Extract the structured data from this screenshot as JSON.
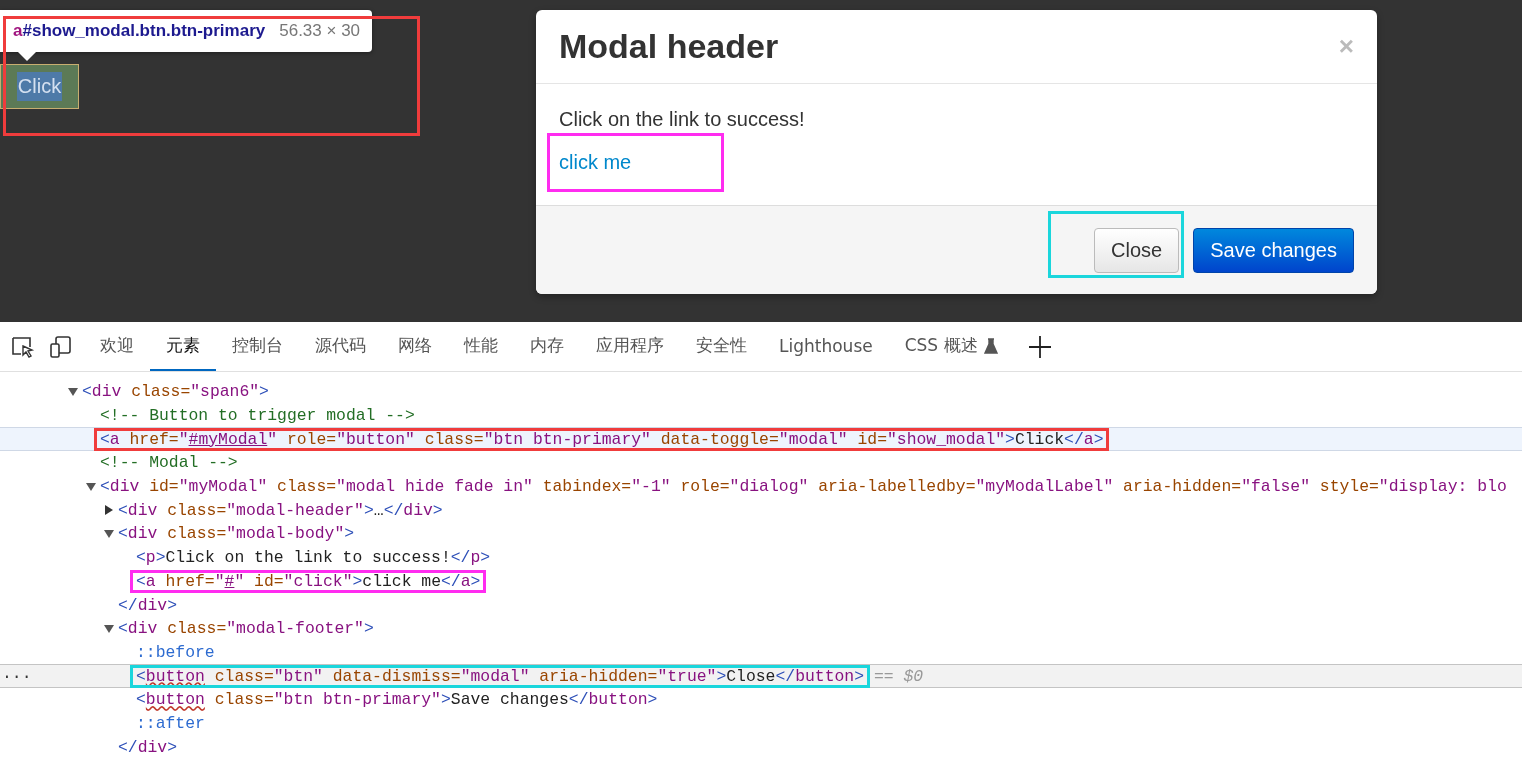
{
  "page": {
    "inspect_tooltip": {
      "tag": "a",
      "selector": "#show_modal.btn.btn-primary",
      "size": "56.33 × 30",
      "highlight": {
        "color": "#f03c3c"
      }
    },
    "trigger_button": {
      "label": "Click",
      "hovered": true
    },
    "modal": {
      "title": "Modal header",
      "close_glyph": "×",
      "body_text": "Click on the link to success!",
      "link": {
        "label": "click me",
        "highlight": {
          "color": "#ff2cf0"
        }
      },
      "buttons": [
        {
          "label": "Close",
          "kind": "default",
          "highlight": {
            "color": "#1ad6dc"
          }
        },
        {
          "label": "Save changes",
          "kind": "primary"
        }
      ]
    }
  },
  "devtools": {
    "tool_icons": [
      {
        "kind": "inspect"
      },
      {
        "kind": "device"
      }
    ],
    "tabs": [
      {
        "label": "欢迎",
        "selected": false
      },
      {
        "label": "元素",
        "selected": true
      },
      {
        "label": "控制台",
        "selected": false
      },
      {
        "label": "源代码",
        "selected": false
      },
      {
        "label": "网络",
        "selected": false
      },
      {
        "label": "性能",
        "selected": false
      },
      {
        "label": "内存",
        "selected": false
      },
      {
        "label": "应用程序",
        "selected": false
      },
      {
        "label": "安全性",
        "selected": false
      },
      {
        "label": "Lighthouse",
        "selected": false
      },
      {
        "label": "CSS 概述",
        "selected": false,
        "experimental": true
      }
    ],
    "dom_tree": [
      {
        "selected": false,
        "hovered": false,
        "expanded": true,
        "tokens": [
          {
            "kind": "bracket",
            "text": "<"
          },
          {
            "kind": "tag",
            "text": "div"
          },
          {
            "kind": "attr",
            "text": " class="
          },
          {
            "kind": "value",
            "text": "\"span6\""
          },
          {
            "kind": "bracket",
            "text": ">"
          }
        ],
        "children": [
          {
            "selected": false,
            "hovered": false,
            "tokens": [
              {
                "kind": "comment",
                "text": "<!-- Button to trigger modal -->"
              }
            ]
          },
          {
            "selected": false,
            "hovered": true,
            "highlight": {
              "color": "#f03c3c"
            },
            "tokens": [
              {
                "kind": "bracket",
                "text": "<"
              },
              {
                "kind": "tag",
                "text": "a"
              },
              {
                "kind": "attr",
                "text": " href="
              },
              {
                "kind": "value",
                "text": "\""
              },
              {
                "kind": "link",
                "text": "#myModal"
              },
              {
                "kind": "value",
                "text": "\""
              },
              {
                "kind": "attr",
                "text": " role="
              },
              {
                "kind": "value",
                "text": "\"button\""
              },
              {
                "kind": "attr",
                "text": " class="
              },
              {
                "kind": "value",
                "text": "\"btn btn-primary\""
              },
              {
                "kind": "attr",
                "text": " data-toggle="
              },
              {
                "kind": "value",
                "text": "\"modal\""
              },
              {
                "kind": "attr",
                "text": " id="
              },
              {
                "kind": "value",
                "text": "\"show_modal\""
              },
              {
                "kind": "bracket",
                "text": ">"
              },
              {
                "kind": "text",
                "text": "Click"
              },
              {
                "kind": "bracket",
                "text": "</"
              },
              {
                "kind": "tag",
                "text": "a"
              },
              {
                "kind": "bracket",
                "text": ">"
              }
            ]
          },
          {
            "selected": false,
            "hovered": false,
            "tokens": [
              {
                "kind": "comment",
                "text": "<!-- Modal -->"
              }
            ]
          },
          {
            "selected": false,
            "hovered": false,
            "expanded": true,
            "tokens": [
              {
                "kind": "bracket",
                "text": "<"
              },
              {
                "kind": "tag",
                "text": "div"
              },
              {
                "kind": "attr",
                "text": " id="
              },
              {
                "kind": "value",
                "text": "\"myModal\""
              },
              {
                "kind": "attr",
                "text": " class="
              },
              {
                "kind": "value",
                "text": "\"modal hide fade in\""
              },
              {
                "kind": "attr",
                "text": " tabindex="
              },
              {
                "kind": "value",
                "text": "\"-1\""
              },
              {
                "kind": "attr",
                "text": " role="
              },
              {
                "kind": "value",
                "text": "\"dialog\""
              },
              {
                "kind": "attr",
                "text": " aria-labelledby="
              },
              {
                "kind": "value",
                "text": "\"myModalLabel\""
              },
              {
                "kind": "attr",
                "text": " aria-hidden="
              },
              {
                "kind": "value",
                "text": "\"false\""
              },
              {
                "kind": "attr",
                "text": " style="
              },
              {
                "kind": "value",
                "text": "\"display: blo"
              }
            ],
            "children": [
              {
                "selected": false,
                "hovered": false,
                "expanded": false,
                "tokens": [
                  {
                    "kind": "bracket",
                    "text": "<"
                  },
                  {
                    "kind": "tag",
                    "text": "div"
                  },
                  {
                    "kind": "attr",
                    "text": " class="
                  },
                  {
                    "kind": "value",
                    "text": "\"modal-header\""
                  },
                  {
                    "kind": "bracket",
                    "text": ">"
                  },
                  {
                    "kind": "text",
                    "text": "…"
                  },
                  {
                    "kind": "bracket",
                    "text": "</"
                  },
                  {
                    "kind": "tag",
                    "text": "div"
                  },
                  {
                    "kind": "bracket",
                    "text": ">"
                  }
                ]
              },
              {
                "selected": false,
                "hovered": false,
                "expanded": true,
                "tokens": [
                  {
                    "kind": "bracket",
                    "text": "<"
                  },
                  {
                    "kind": "tag",
                    "text": "div"
                  },
                  {
                    "kind": "attr",
                    "text": " class="
                  },
                  {
                    "kind": "value",
                    "text": "\"modal-body\""
                  },
                  {
                    "kind": "bracket",
                    "text": ">"
                  }
                ],
                "children": [
                  {
                    "selected": false,
                    "hovered": false,
                    "tokens": [
                      {
                        "kind": "bracket",
                        "text": "<"
                      },
                      {
                        "kind": "tag",
                        "text": "p"
                      },
                      {
                        "kind": "bracket",
                        "text": ">"
                      },
                      {
                        "kind": "text",
                        "text": "Click on the link to success!"
                      },
                      {
                        "kind": "bracket",
                        "text": "</"
                      },
                      {
                        "kind": "tag",
                        "text": "p"
                      },
                      {
                        "kind": "bracket",
                        "text": ">"
                      }
                    ]
                  },
                  {
                    "selected": false,
                    "hovered": false,
                    "highlight": {
                      "color": "#ff2cf0"
                    },
                    "tokens": [
                      {
                        "kind": "bracket",
                        "text": "<"
                      },
                      {
                        "kind": "tag",
                        "text": "a"
                      },
                      {
                        "kind": "attr",
                        "text": " href="
                      },
                      {
                        "kind": "value",
                        "text": "\""
                      },
                      {
                        "kind": "link",
                        "text": "#"
                      },
                      {
                        "kind": "value",
                        "text": "\""
                      },
                      {
                        "kind": "attr",
                        "text": " id="
                      },
                      {
                        "kind": "value",
                        "text": "\"click\""
                      },
                      {
                        "kind": "bracket",
                        "text": ">"
                      },
                      {
                        "kind": "text",
                        "text": "click me"
                      },
                      {
                        "kind": "bracket",
                        "text": "</"
                      },
                      {
                        "kind": "tag",
                        "text": "a"
                      },
                      {
                        "kind": "bracket",
                        "text": ">"
                      }
                    ]
                  }
                ]
              },
              {
                "selected": false,
                "hovered": false,
                "tokens": [
                  {
                    "kind": "bracket",
                    "text": "</"
                  },
                  {
                    "kind": "tag",
                    "text": "div"
                  },
                  {
                    "kind": "bracket",
                    "text": ">"
                  }
                ]
              },
              {
                "selected": false,
                "hovered": false,
                "expanded": true,
                "tokens": [
                  {
                    "kind": "bracket",
                    "text": "<"
                  },
                  {
                    "kind": "tag",
                    "text": "div"
                  },
                  {
                    "kind": "attr",
                    "text": " class="
                  },
                  {
                    "kind": "value",
                    "text": "\"modal-footer\""
                  },
                  {
                    "kind": "bracket",
                    "text": ">"
                  }
                ],
                "children": [
                  {
                    "selected": false,
                    "hovered": false,
                    "tokens": [
                      {
                        "kind": "pseudo",
                        "text": "::before"
                      }
                    ]
                  },
                  {
                    "selected": true,
                    "hovered": false,
                    "highlight": {
                      "color": "#1ad6dc"
                    },
                    "gutter": "···",
                    "tokens": [
                      {
                        "kind": "bracket",
                        "text": "<"
                      },
                      {
                        "kind": "wavy-tag",
                        "text": "button"
                      },
                      {
                        "kind": "attr",
                        "text": " class="
                      },
                      {
                        "kind": "value",
                        "text": "\"btn\""
                      },
                      {
                        "kind": "attr",
                        "text": " data-dismiss="
                      },
                      {
                        "kind": "value",
                        "text": "\"modal\""
                      },
                      {
                        "kind": "attr",
                        "text": " aria-hidden="
                      },
                      {
                        "kind": "value",
                        "text": "\"true\""
                      },
                      {
                        "kind": "bracket",
                        "text": ">"
                      },
                      {
                        "kind": "text",
                        "text": "Close"
                      },
                      {
                        "kind": "bracket",
                        "text": "</"
                      },
                      {
                        "kind": "tag",
                        "text": "button"
                      },
                      {
                        "kind": "bracket",
                        "text": ">"
                      }
                    ],
                    "hint": "== $0"
                  },
                  {
                    "selected": false,
                    "hovered": false,
                    "tokens": [
                      {
                        "kind": "bracket",
                        "text": "<"
                      },
                      {
                        "kind": "wavy-tag",
                        "text": "button"
                      },
                      {
                        "kind": "attr",
                        "text": " class="
                      },
                      {
                        "kind": "value",
                        "text": "\"btn btn-primary\""
                      },
                      {
                        "kind": "bracket",
                        "text": ">"
                      },
                      {
                        "kind": "text",
                        "text": "Save changes"
                      },
                      {
                        "kind": "bracket",
                        "text": "</"
                      },
                      {
                        "kind": "tag",
                        "text": "button"
                      },
                      {
                        "kind": "bracket",
                        "text": ">"
                      }
                    ]
                  },
                  {
                    "selected": false,
                    "hovered": false,
                    "tokens": [
                      {
                        "kind": "pseudo",
                        "text": "::after"
                      }
                    ]
                  }
                ]
              },
              {
                "selected": false,
                "hovered": false,
                "tokens": [
                  {
                    "kind": "bracket",
                    "text": "</"
                  },
                  {
                    "kind": "tag",
                    "text": "div"
                  },
                  {
                    "kind": "bracket",
                    "text": ">"
                  }
                ]
              }
            ]
          }
        ]
      }
    ]
  }
}
